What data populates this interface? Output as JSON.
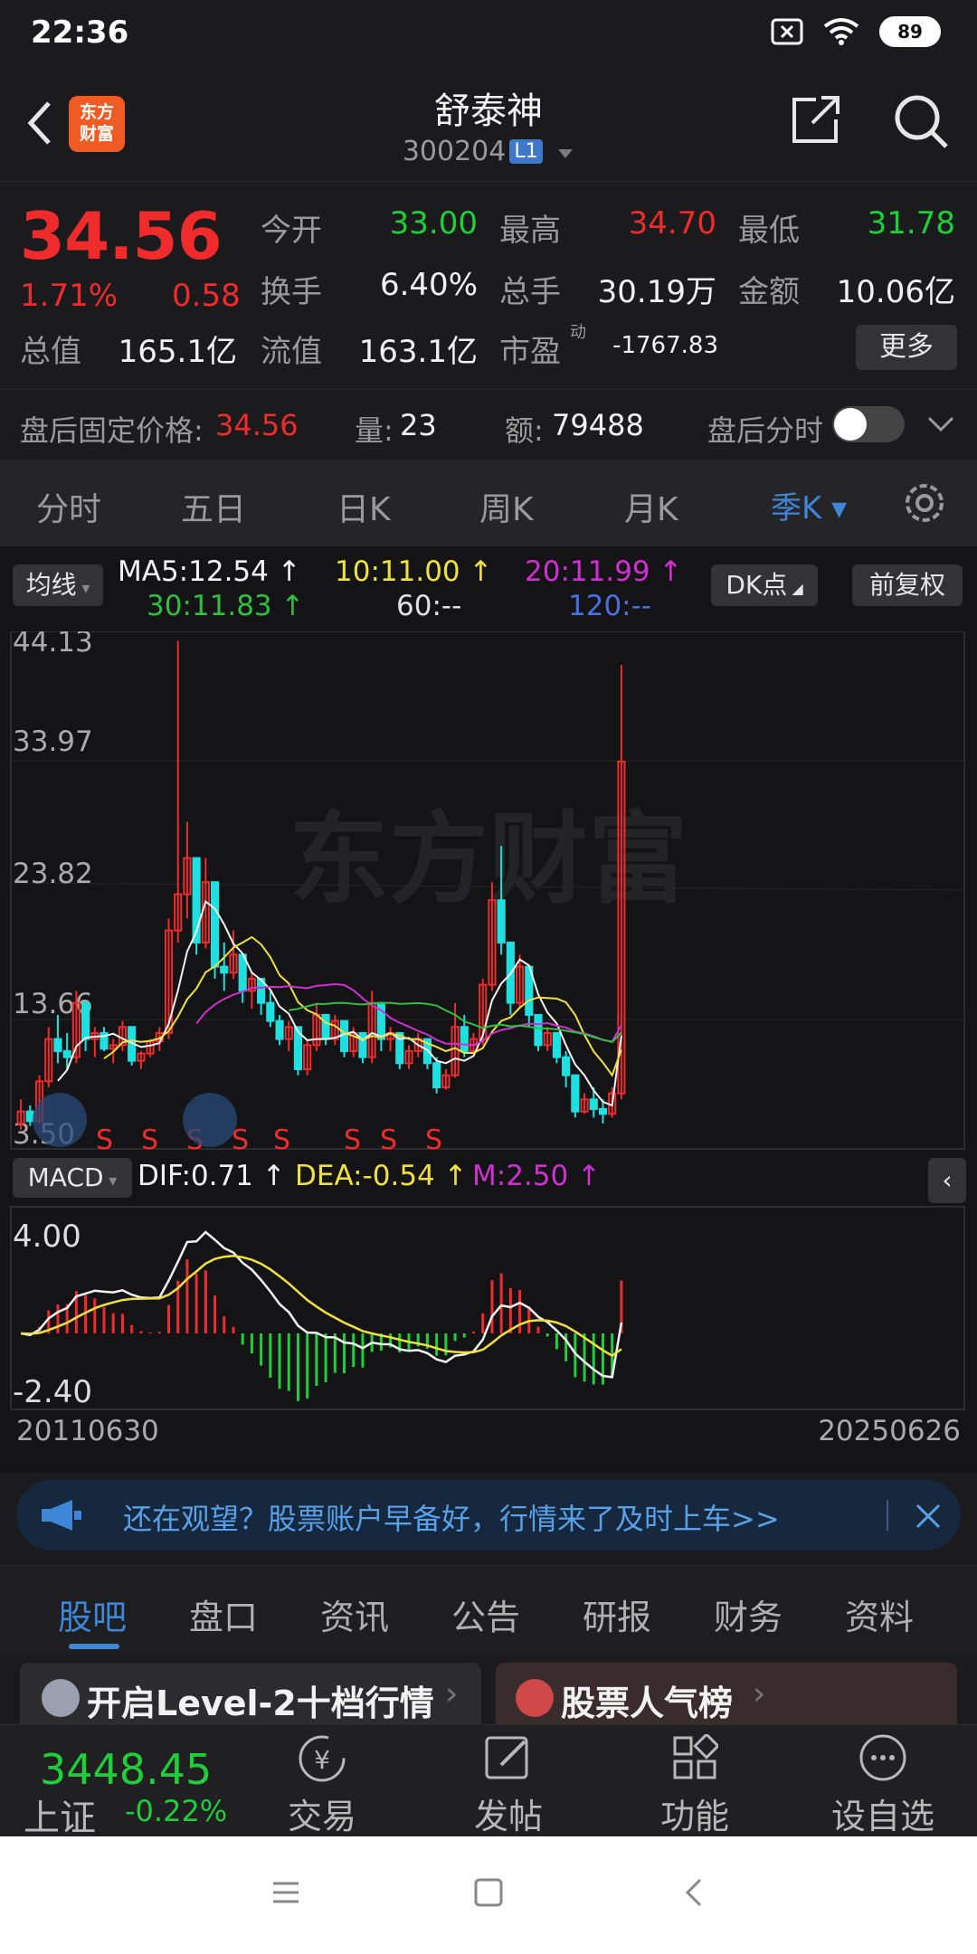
{
  "status_bar": {
    "time": "22:36",
    "battery": "89"
  },
  "header": {
    "title": "舒泰神",
    "code": "300204",
    "level_badge": "L1",
    "logo_text_1": "东方",
    "logo_text_2": "财富"
  },
  "quote": {
    "price": "34.56",
    "change_pct": "1.71%",
    "change": "0.58",
    "fields": [
      {
        "label": "今开",
        "value": "33.00",
        "color": "green"
      },
      {
        "label": "最高",
        "value": "34.70",
        "color": "red"
      },
      {
        "label": "最低",
        "value": "31.78",
        "color": "green"
      },
      {
        "label": "换手",
        "value": "6.40%",
        "color": "white"
      },
      {
        "label": "总手",
        "value": "30.19万",
        "color": "white"
      },
      {
        "label": "金额",
        "value": "10.06亿",
        "color": "white"
      },
      {
        "label": "总值",
        "value": "165.1亿",
        "color": "white"
      },
      {
        "label": "流值",
        "value": "163.1亿",
        "color": "white"
      },
      {
        "label": "市盈",
        "value": "-1767.83",
        "color": "white"
      }
    ],
    "pe_superscript": "动",
    "more_label": "更多"
  },
  "after_hours": {
    "price_label": "盘后固定价格:",
    "price": "34.56",
    "volume_label": "量:",
    "volume": "23",
    "amount_label": "额:",
    "amount": "79488",
    "timeshare_label": "盘后分时"
  },
  "periods": [
    "分时",
    "五日",
    "日K",
    "周K",
    "月K",
    "季K"
  ],
  "active_period": "季K",
  "chart": {
    "ma_button": "均线",
    "ma": [
      {
        "text": "MA5:12.54",
        "color": "#f2f2f2"
      },
      {
        "text": "10:11.00",
        "color": "#f0e040"
      },
      {
        "text": "20:11.99",
        "color": "#d030d0"
      },
      {
        "text": "30:11.83",
        "color": "#30c040"
      },
      {
        "text": "60:--",
        "color": "#e0e0e0"
      },
      {
        "text": "120:--",
        "color": "#4a70e0"
      }
    ],
    "dk_button": "DK点",
    "fq_button": "前复权",
    "y_labels": [
      "44.13",
      "33.97",
      "23.82",
      "13.66",
      "3.50"
    ],
    "watermark": "东方财富",
    "s_marker": "S",
    "macd_button": "MACD",
    "dif": "DIF:0.71",
    "dea": "DEA:-0.54",
    "m": "M:2.50",
    "macd_labels": [
      "4.00",
      "-2.40"
    ],
    "date_start": "20110630",
    "date_end": "20250626"
  },
  "chart_data": {
    "type": "candlestick",
    "title": "舒泰神 季K",
    "ylim": [
      3.5,
      44.13
    ],
    "candles": [
      [
        5,
        7,
        4.5,
        6
      ],
      [
        6,
        6.5,
        4.8,
        5.2
      ],
      [
        5.2,
        9,
        5,
        8.5
      ],
      [
        8.5,
        13,
        8,
        12
      ],
      [
        12,
        14,
        10,
        11
      ],
      [
        11,
        12.5,
        9.5,
        10.5
      ],
      [
        10.5,
        16,
        10,
        15
      ],
      [
        15,
        14,
        11,
        12
      ],
      [
        12,
        13,
        10.5,
        12.5
      ],
      [
        12.5,
        13,
        11,
        11.2
      ],
      [
        11.2,
        12,
        10,
        11.5
      ],
      [
        11.5,
        13.5,
        11,
        13
      ],
      [
        13,
        12,
        9.8,
        10.2
      ],
      [
        10.2,
        11,
        9.5,
        10.8
      ],
      [
        10.8,
        12,
        10.5,
        11.8
      ],
      [
        11.8,
        13,
        11,
        12.5
      ],
      [
        12.5,
        22,
        12,
        21
      ],
      [
        21,
        45,
        20,
        24
      ],
      [
        24,
        30,
        22,
        27
      ],
      [
        27,
        26,
        19,
        20
      ],
      [
        20,
        27,
        19.5,
        25
      ],
      [
        25,
        24,
        17,
        18
      ],
      [
        18,
        20,
        16,
        17.5
      ],
      [
        17.5,
        21,
        17,
        19
      ],
      [
        19,
        18,
        15,
        16
      ],
      [
        16,
        17.5,
        14.5,
        17
      ],
      [
        17,
        16.5,
        14,
        15
      ],
      [
        15,
        16,
        13,
        13.5
      ],
      [
        13.5,
        14,
        11.5,
        12
      ],
      [
        12,
        13.5,
        11,
        13
      ],
      [
        13,
        12.5,
        9,
        9.5
      ],
      [
        9.5,
        12,
        9,
        11.5
      ],
      [
        11.5,
        15,
        11,
        14
      ],
      [
        14,
        13.5,
        11.5,
        12
      ],
      [
        12,
        14,
        11.5,
        13.5
      ],
      [
        13.5,
        13,
        10.5,
        11
      ],
      [
        11,
        13,
        10.5,
        12.5
      ],
      [
        12.5,
        12,
        10,
        10.5
      ],
      [
        10.5,
        16,
        10,
        15
      ],
      [
        15,
        14.5,
        11,
        12
      ],
      [
        12,
        13,
        11,
        12.5
      ],
      [
        12.5,
        12,
        9.5,
        10
      ],
      [
        10,
        11.5,
        9.5,
        11
      ],
      [
        11,
        12.5,
        10.5,
        12
      ],
      [
        12,
        11.5,
        9.5,
        10
      ],
      [
        10,
        10.5,
        7.5,
        8
      ],
      [
        8,
        9.5,
        7.8,
        9
      ],
      [
        9,
        15,
        8.8,
        13
      ],
      [
        13,
        14,
        10.5,
        11
      ],
      [
        11,
        12.5,
        10.8,
        12
      ],
      [
        12,
        17,
        11.5,
        16.5
      ],
      [
        16.5,
        25,
        16,
        23.5
      ],
      [
        23.5,
        28,
        19,
        20
      ],
      [
        20,
        17,
        14,
        15
      ],
      [
        15,
        19,
        14.5,
        18
      ],
      [
        18,
        17,
        13,
        14
      ],
      [
        14,
        13.5,
        11,
        11.5
      ],
      [
        11.5,
        13,
        11,
        12.5
      ],
      [
        12.5,
        12,
        10,
        10.5
      ],
      [
        10.5,
        11,
        8,
        9
      ],
      [
        9,
        8.5,
        5.5,
        6
      ],
      [
        6,
        7.5,
        5.8,
        7
      ],
      [
        7,
        8,
        5.5,
        6.2
      ],
      [
        6.2,
        7,
        5,
        5.8
      ],
      [
        5.8,
        8,
        5.5,
        7.5
      ],
      [
        7.5,
        43,
        7,
        35
      ]
    ],
    "macd": {
      "dif": 0.71,
      "dea": -0.54,
      "m": 2.5,
      "ylim": [
        -2.4,
        4.0
      ]
    }
  },
  "banner": {
    "text": "还在观望？股票账户早备好，行情来了及时上车>>"
  },
  "content_tabs": [
    "股吧",
    "盘口",
    "资讯",
    "公告",
    "研报",
    "财务",
    "资料"
  ],
  "active_content_tab": "股吧",
  "cards": [
    {
      "text": "开启Level-2十档行情"
    },
    {
      "text": "股票人气榜"
    }
  ],
  "bottom_nav": {
    "index_value": "3448.45",
    "index_name": "上证",
    "index_change": "-0.22%",
    "items": [
      "交易",
      "发帖",
      "功能",
      "设自选"
    ]
  },
  "colors": {
    "up": "#f02b2b",
    "down": "#1fcf3a",
    "accent": "#3f86d8"
  }
}
